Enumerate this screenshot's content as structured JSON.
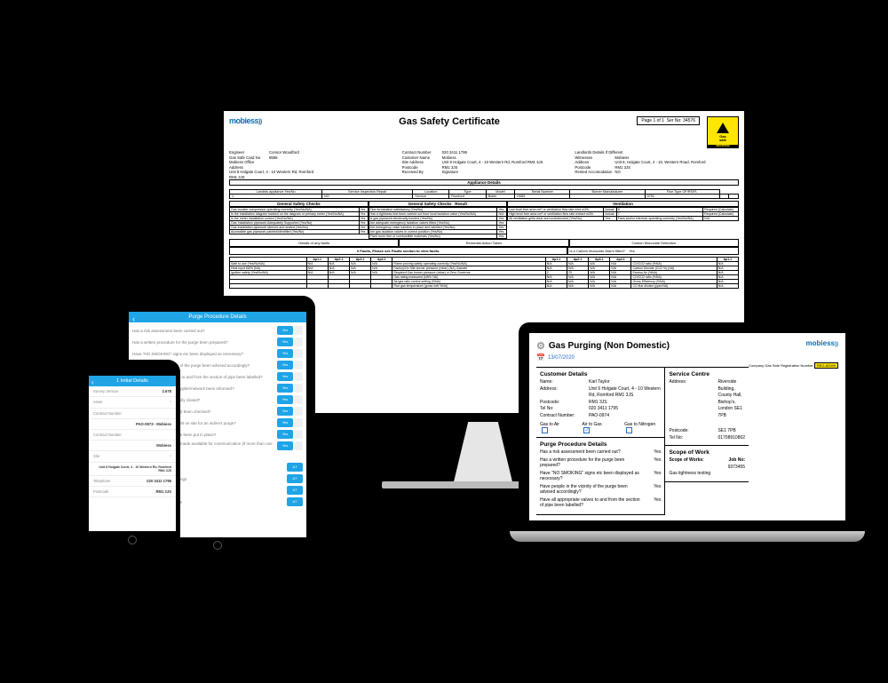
{
  "monitor": {
    "logo": "mobiess",
    "title": "Gas Safety Certificate",
    "page": "Page 1 of 1",
    "ser": "Ser No: 34576",
    "engineer": {
      "engineer_lbl": "Engineer",
      "engineer_val": "Connor Woodford",
      "card_lbl": "Gas Safe Card No",
      "card_val": "8555",
      "addr_lbl": "Mobiess Office Address",
      "addr_val": "Unit 8 Holgate Court, 4 - 10 Western Rd, Romford",
      "pc_lbl": "",
      "pc_val": "RM1 3JS"
    },
    "contract": {
      "num_lbl": "Contract Number",
      "num_val": "020 3411 1795",
      "cust_lbl": "Customer Name",
      "cust_val": "Mobiess",
      "site_lbl": "Site Address",
      "site_val": "Unit 8 Holgate Court, 4 - 10 Western Rd, Romford RM1 3JS",
      "pc_lbl": "Postcode",
      "pc_val": "RM1 3JS",
      "recv_lbl": "Received By",
      "sig_lbl": "Signature"
    },
    "landlord": {
      "title_lbl": "Landlords Details If Different",
      "name_lbl": "Witnesses",
      "name_val": "Mobiess",
      "addr_lbl": "Address",
      "addr_val": "Unit 8, Holgate Court, 4 - 10, Western Road, Romford",
      "pc_lbl": "Postcode",
      "pc_val": "RM1 3JS",
      "rent_lbl": "Rented Accomodation",
      "rent_val": "NO"
    },
    "appl_title": "Appliance Details",
    "appl_headers": [
      "Landrds appliance Yes/No",
      "Service Inspection Repair",
      "Location",
      "Type",
      "Model",
      "Serial Number",
      "Burner Manufacturer",
      "Flue Type OF/RS/FL"
    ],
    "appl_row": [
      "1",
      "NO",
      "Service",
      "Romford",
      "Boiler",
      "H065",
      "",
      "5791",
      "",
      ""
    ],
    "gsc1_title": "General Safety Checks",
    "gsc2_title": "General Safety Checks",
    "vent_title": "Ventilation",
    "gsc1_rows": [
      [
        "Gas booster compressor operating correctly (Yes/No/NA)",
        "Yes"
      ],
      [
        "Is the installation diagram marked on the diagram or primary meter (Yes/No/NA)",
        "Yes"
      ],
      [
        "Is the meter installation correct (Yes/No/NA)",
        "Yes"
      ],
      [
        "Gas Installation pipework Adequately Supported (Yes/No)",
        "Yes"
      ],
      [
        "Gas installation pipework sleeved and sealed (Yes/No)",
        "Yes"
      ],
      [
        "Accessible gas pipework painted/identified (Yes/No)",
        "Yes"
      ]
    ],
    "gsc2_rows": [
      [
        "Flue termination satisfactory (Yes/No)",
        "Yes"
      ],
      [
        "Has a tightness test been carried out from local isolation valve (Yes/No/NA)",
        "N/A"
      ],
      [
        "Is gas pipework electrically bonded (Yes/No)",
        "Yes"
      ],
      [
        "Are adequate emergency isolation valves fitted (Yes/No)",
        "Yes"
      ],
      [
        "Are emergency valve handles in place and labelled (Yes/No)",
        "Yes"
      ],
      [
        "Are gas isolation valves in correct position (Yes/No)",
        "Yes"
      ],
      [
        "Plant room free of combustible materials (Yes/No)",
        "Yes"
      ]
    ],
    "vent_rows": [
      [
        "Low level free area cm² or ventilation flow rate inlet m3/h",
        "Actual",
        "8",
        "Required (Calculate)"
      ],
      [
        "High level free area cm² or ventilation flow rate extract m3/h",
        "Actual",
        "7",
        "Required (Calculate)"
      ],
      [
        "All ventilation grills clear and unobstructed (Yes/No)",
        "Yes",
        "Fans and/or interlock operating correctly (Yes/No/NA)",
        "N/A"
      ]
    ],
    "faults_h": [
      "Details of any faults",
      "Remedial Action Taken",
      "Carbon Monoxide Detection"
    ],
    "faults_note": "0 Faults, Please see Faults section to view faults.",
    "co_q": "Is a Carbon Monoxide Alarm fitted?",
    "co_a": "Yes",
    "comb_heads": [
      "",
      "Ap1.1",
      "Ap2.1",
      "Ap3.1",
      "Ap4.1",
      "",
      "Ap1.1",
      "Ap2.1",
      "Ap3.1",
      "Ap4.1",
      "",
      "Ap1.1"
    ],
    "comb_rows": [
      [
        "Safe to use (Yes/No/NA)",
        "N/A",
        "N/A",
        "N/A",
        "N/A",
        "Flame proving safety operating correctly (Yes/No/NA)",
        "N/A",
        "N/A",
        "N/A",
        "N/A",
        "CO/CO2 ratio (%NA)",
        "N/A"
      ],
      [
        "Heat input kW/h (NA)",
        "N/A",
        "N/A",
        "N/A",
        "N/A",
        "Factory/On Site burner pressure (mbar) (NA) Gasrate",
        "N/A",
        "N/A",
        "N/A",
        "N/A",
        "Carbon Dioxide (CO2 %) (NA)",
        "N/A"
      ],
      [
        "Ignition safety (Yes/No/NA)",
        "N/A",
        "N/A",
        "N/A",
        "N/A",
        "Required Gas burner pressure (mbar) or Zero Governor",
        "2",
        "23",
        "N/A",
        "N/A",
        "Excess Air (%NA)",
        "N/A"
      ],
      [
        "",
        "",
        "",
        "",
        "",
        "Gas rating measured (kW/h NA)",
        "N/A",
        "N/A",
        "N/A",
        "N/A",
        "CO/CO2 ratio (%NA)",
        "N/A"
      ],
      [
        "",
        "",
        "",
        "",
        "",
        "Air/gas ratio control setting (%NA)",
        "N/A",
        "N/A",
        "N/A",
        "N/A",
        "Gross Efficiency (%NA)",
        "N/A"
      ],
      [
        "",
        "",
        "",
        "",
        "",
        "Flue gas temperature (gross nett %NA)",
        "N/A",
        "N/A",
        "N/A",
        "N/A",
        "CO flue dilution (ppm/NA)",
        "N/A"
      ]
    ]
  },
  "laptop": {
    "title": "Gas Purging (Non Domestic)",
    "date": "13/07/2020",
    "logo": "mobiess",
    "reg_lbl": "Company Gas Safe Registration Number",
    "reg_val": "REG-82949",
    "cust_title": "Customer Details",
    "svc_title": "Service Centre",
    "cust": {
      "name_l": "Name:",
      "name_v": "Karl Taylor",
      "addr_l": "Address:",
      "addr_v": "Unit 9 Holgate Court, 4 - 10 Western Rd, Romford RM1 3JS",
      "pc_l": "Postcode:",
      "pc_v": "RM1 3JS",
      "tel_l": "Tel No:",
      "tel_v": "020 3411 1795",
      "cn_l": "Contract Number:",
      "cn_v": "PAO-0974"
    },
    "svc": {
      "addr_l": "Address:",
      "addr_v": "Riverside Building, County Hall, Bishop's, London SE1 7PB",
      "pc_l": "Postcode:",
      "pc_v": "SE1 7PB",
      "tel_l": "Tel No:",
      "tel_v": "01708910802"
    },
    "gas_opts": [
      {
        "label": "Gas to Air",
        "checked": false
      },
      {
        "label": "Air to Gas",
        "checked": true
      },
      {
        "label": "Gas to Nitrogen",
        "checked": false
      }
    ],
    "ppd_title": "Purge Procedure Details",
    "scope_title": "Scope of Work",
    "scope_l": "Scope of Works:",
    "job_l": "Job No:",
    "job_v": "9373455",
    "scope_v": "Gas tightness testing",
    "ppd_qs": [
      {
        "q": "Has a risk assessment been carried out?",
        "a": "Yes"
      },
      {
        "q": "Has a written procedure for the purge been prepared?",
        "a": "Yes"
      },
      {
        "q": "Have \"NO SMOKING\" signs etc been displayed as necessary?",
        "a": "Yes"
      },
      {
        "q": "Have people in the vicinity of the purge been advised accordingly?",
        "a": "Yes"
      },
      {
        "q": "Have all appropriate valves to and from the section of pipe been labelled?",
        "a": "Yes"
      }
    ]
  },
  "tablet": {
    "title": "Purge Procedure Details",
    "qs": [
      "Has a risk assessment been carried out?",
      "Has a written procedure for the purge been prepared?",
      "Have \"NO SMOKING\" signs etc been displayed as necessary?",
      "Have people in the vicinity of the purge been advised accordingly?",
      "Have all appropriate valves to and from the section of pipe been labelled?",
      "Has the appropriate gas supplier/network been informed?",
      "Is the meter control valve fully closed?",
      "Has the meter by-pass (if fit) been checked?",
      "Is any nitrogen being brought on site for an indirect purge?",
      "Have no smoking procedure been put in place?",
      "Have two way radios been made available for communication (if more than one person)?"
    ],
    "toggle": "Yes",
    "sec": "late Purge Volume",
    "vol_rows": [
      "Meter Purge Volume (m³)",
      "Installation Pipework & Fittings",
      "Total Purge Volume (m³)",
      "Gas Detection Going Online"
    ],
    "ap": "A7"
  },
  "phone": {
    "title": "1 Initial Details",
    "rows": [
      {
        "l": "Survey Version",
        "v": "2.678",
        "chev": false
      },
      {
        "l": "Asset",
        "v": "",
        "chev": true
      },
      {
        "l": "Contract Number",
        "v": "",
        "chev": false
      },
      {
        "l": "",
        "v": "PAO-0973 - Mobiess",
        "chev": false,
        "bold": true
      },
      {
        "l": "Contract Number",
        "v": "",
        "chev": false
      },
      {
        "l": "",
        "v": "Mobiess",
        "chev": false,
        "bold": true
      },
      {
        "l": "Site",
        "v": "",
        "chev": true
      },
      {
        "l": "",
        "v": "Unit 8 Holgate Court, 4 - 10 Western Rd, Romford RM1 3JS",
        "chev": false,
        "small": true
      },
      {
        "l": "Telephone",
        "v": "020 3411 1795",
        "chev": false
      },
      {
        "l": "Postcode",
        "v": "RM1 3JS",
        "chev": false
      }
    ]
  }
}
